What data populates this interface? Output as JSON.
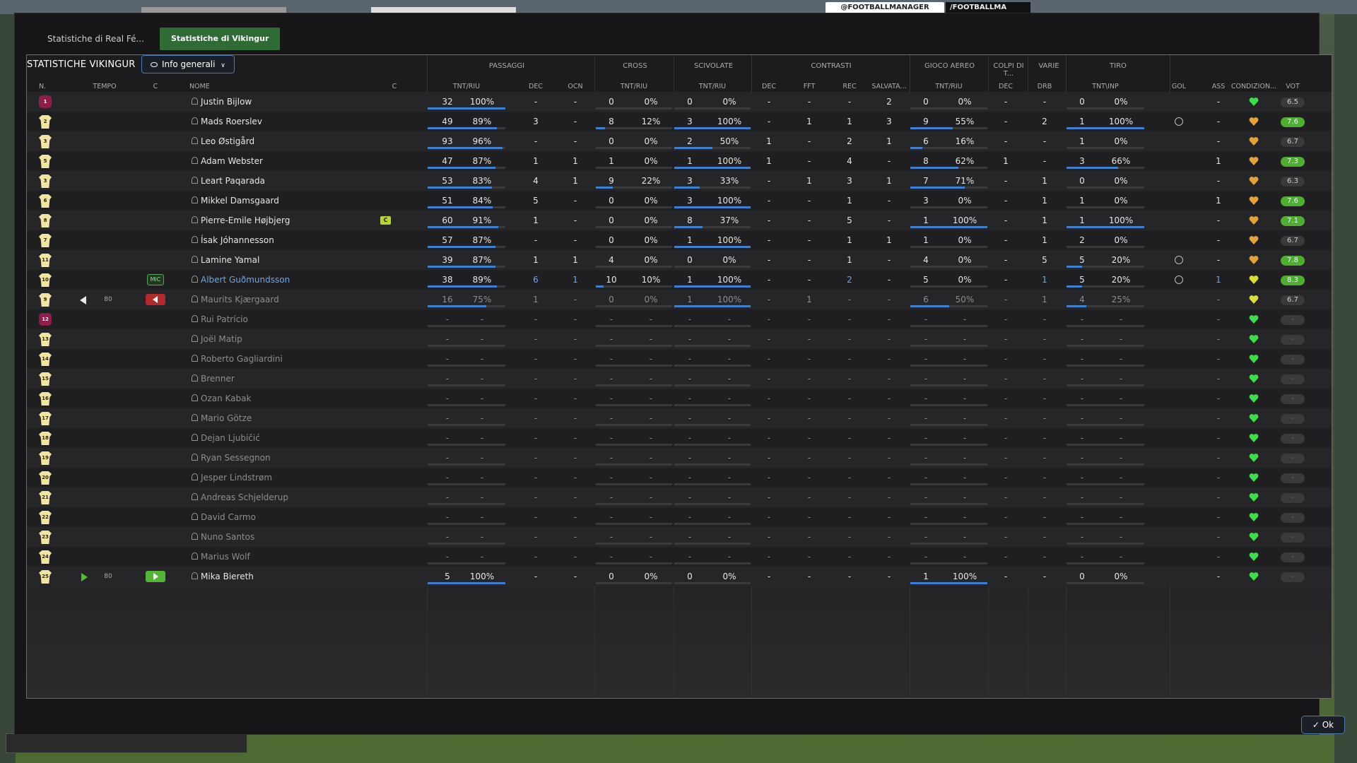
{
  "background": {
    "ad_text_1": "@FOOTBALLMANAGER",
    "ad_text_2": "/FOOTBALLMA"
  },
  "tabs": [
    {
      "label": "Statistiche di Real Fé...",
      "active": false
    },
    {
      "label": "Statistiche di Vikingur",
      "active": true
    }
  ],
  "panel": {
    "title": "STATISTICHE VIKINGUR",
    "filter_label": "Info generali"
  },
  "groups": {
    "passaggi": "PASSAGGI",
    "cross": "CROSS",
    "scivolate": "SCIVOLATE",
    "contrasti": "CONTRASTI",
    "gioco_aereo": "GIOCO AEREO",
    "colpi_di_testa": "COLPI DI T...",
    "varie": "VARIE",
    "tiro": "TIRO"
  },
  "columns": {
    "n": "N.",
    "tempo": "TEMPO",
    "c": "C",
    "nome": "NOME",
    "c2": "C",
    "pass_tnt": "TNT/RIU",
    "pass_dec": "DEC",
    "pass_ocn": "OCN",
    "cross_tnt": "TNT/RIU",
    "sciv_tnt": "TNT/RIU",
    "contr_dec": "DEC",
    "contr_fft": "FFT",
    "contr_rec": "REC",
    "contr_salv": "SALVATA...",
    "aereo_tnt": "TNT/RIU",
    "testa_dec": "DEC",
    "varie_drb": "DRB",
    "tiro_tnt": "TNT\\INP",
    "gol": "GOL",
    "ass": "ASS",
    "condizione": "CONDIZION...",
    "vot": "VOT"
  },
  "players": [
    {
      "n": "1",
      "gk": true,
      "name": "Justin Bijlow",
      "pass_a": "32",
      "pass_p": "100%",
      "pass_fill": 1.0,
      "pass_dec": "-",
      "pass_ocn": "-",
      "cross_a": "0",
      "cross_p": "0%",
      "cross_fill": 0,
      "sciv_a": "0",
      "sciv_p": "0%",
      "sciv_fill": 0,
      "c_dec": "-",
      "c_fft": "-",
      "c_rec": "-",
      "c_salv": "2",
      "aer_a": "0",
      "aer_p": "0%",
      "aer_fill": 0,
      "t_dec": "-",
      "drb": "-",
      "tiro_a": "0",
      "tiro_p": "0%",
      "tiro_fill": 0,
      "gol": "",
      "ass": "-",
      "cond": "green",
      "vot": "6.5",
      "vot_green": false
    },
    {
      "n": "2",
      "name": "Mads Roerslev",
      "pass_a": "49",
      "pass_p": "89%",
      "pass_fill": 0.89,
      "pass_dec": "3",
      "pass_ocn": "-",
      "cross_a": "8",
      "cross_p": "12%",
      "cross_fill": 0.12,
      "sciv_a": "3",
      "sciv_p": "100%",
      "sciv_fill": 1.0,
      "c_dec": "-",
      "c_fft": "1",
      "c_rec": "1",
      "c_salv": "3",
      "aer_a": "9",
      "aer_p": "55%",
      "aer_fill": 0.55,
      "t_dec": "-",
      "drb": "2",
      "tiro_a": "1",
      "tiro_p": "100%",
      "tiro_fill": 1.0,
      "gol": "ball",
      "ass": "-",
      "cond": "orange",
      "vot": "7.6",
      "vot_green": true
    },
    {
      "n": "3",
      "name": "Leo Østigård",
      "pass_a": "93",
      "pass_p": "96%",
      "pass_fill": 0.96,
      "pass_dec": "-",
      "pass_ocn": "-",
      "cross_a": "0",
      "cross_p": "0%",
      "cross_fill": 0,
      "sciv_a": "2",
      "sciv_p": "50%",
      "sciv_fill": 0.5,
      "c_dec": "1",
      "c_fft": "-",
      "c_rec": "2",
      "c_salv": "1",
      "aer_a": "6",
      "aer_p": "16%",
      "aer_fill": 0.16,
      "t_dec": "-",
      "drb": "-",
      "tiro_a": "1",
      "tiro_p": "0%",
      "tiro_fill": 0,
      "gol": "",
      "ass": "-",
      "cond": "orange",
      "vot": "6.7",
      "vot_green": false
    },
    {
      "n": "5",
      "name": "Adam Webster",
      "pass_a": "47",
      "pass_p": "87%",
      "pass_fill": 0.87,
      "pass_dec": "1",
      "pass_ocn": "1",
      "cross_a": "1",
      "cross_p": "0%",
      "cross_fill": 0,
      "sciv_a": "1",
      "sciv_p": "100%",
      "sciv_fill": 1.0,
      "c_dec": "1",
      "c_fft": "-",
      "c_rec": "4",
      "c_salv": "-",
      "aer_a": "8",
      "aer_p": "62%",
      "aer_fill": 0.62,
      "t_dec": "1",
      "drb": "-",
      "tiro_a": "3",
      "tiro_p": "66%",
      "tiro_fill": 0.66,
      "gol": "",
      "ass": "1",
      "cond": "orange",
      "vot": "7.3",
      "vot_green": true
    },
    {
      "n": "3",
      "name": "Leart Paqarada",
      "pass_a": "53",
      "pass_p": "83%",
      "pass_fill": 0.83,
      "pass_dec": "4",
      "pass_ocn": "1",
      "cross_a": "9",
      "cross_p": "22%",
      "cross_fill": 0.22,
      "sciv_a": "3",
      "sciv_p": "33%",
      "sciv_fill": 0.33,
      "c_dec": "-",
      "c_fft": "1",
      "c_rec": "3",
      "c_salv": "1",
      "aer_a": "7",
      "aer_p": "71%",
      "aer_fill": 0.71,
      "t_dec": "-",
      "drb": "1",
      "tiro_a": "0",
      "tiro_p": "0%",
      "tiro_fill": 0,
      "gol": "",
      "ass": "-",
      "cond": "orange",
      "vot": "6.3",
      "vot_green": false
    },
    {
      "n": "6",
      "name": "Mikkel Damsgaard",
      "pass_a": "51",
      "pass_p": "84%",
      "pass_fill": 0.84,
      "pass_dec": "5",
      "pass_ocn": "-",
      "cross_a": "0",
      "cross_p": "0%",
      "cross_fill": 0,
      "sciv_a": "3",
      "sciv_p": "100%",
      "sciv_fill": 1.0,
      "c_dec": "-",
      "c_fft": "-",
      "c_rec": "1",
      "c_salv": "-",
      "aer_a": "3",
      "aer_p": "0%",
      "aer_fill": 0,
      "t_dec": "-",
      "drb": "1",
      "tiro_a": "1",
      "tiro_p": "0%",
      "tiro_fill": 0,
      "gol": "",
      "ass": "1",
      "cond": "orange",
      "vot": "7.6",
      "vot_green": true
    },
    {
      "n": "8",
      "name": "Pierre-Emile Højbjerg",
      "captain": true,
      "cap_label": "C",
      "pass_a": "60",
      "pass_p": "91%",
      "pass_fill": 0.91,
      "pass_dec": "1",
      "pass_ocn": "-",
      "cross_a": "0",
      "cross_p": "0%",
      "cross_fill": 0,
      "sciv_a": "8",
      "sciv_p": "37%",
      "sciv_fill": 0.37,
      "c_dec": "-",
      "c_fft": "-",
      "c_rec": "5",
      "c_salv": "-",
      "aer_a": "1",
      "aer_p": "100%",
      "aer_fill": 1.0,
      "t_dec": "-",
      "drb": "1",
      "tiro_a": "1",
      "tiro_p": "100%",
      "tiro_fill": 1.0,
      "gol": "",
      "ass": "-",
      "cond": "orange",
      "vot": "7.1",
      "vot_green": true
    },
    {
      "n": "7",
      "name": "Ísak Jóhannesson",
      "pass_a": "57",
      "pass_p": "87%",
      "pass_fill": 0.87,
      "pass_dec": "-",
      "pass_ocn": "-",
      "cross_a": "0",
      "cross_p": "0%",
      "cross_fill": 0,
      "sciv_a": "1",
      "sciv_p": "100%",
      "sciv_fill": 1.0,
      "c_dec": "-",
      "c_fft": "-",
      "c_rec": "1",
      "c_salv": "1",
      "aer_a": "1",
      "aer_p": "0%",
      "aer_fill": 0,
      "t_dec": "-",
      "drb": "1",
      "tiro_a": "2",
      "tiro_p": "0%",
      "tiro_fill": 0,
      "gol": "",
      "ass": "-",
      "cond": "orange",
      "vot": "6.7",
      "vot_green": false
    },
    {
      "n": "11",
      "name": "Lamine Yamal",
      "pass_a": "39",
      "pass_p": "87%",
      "pass_fill": 0.87,
      "pass_dec": "1",
      "pass_ocn": "1",
      "cross_a": "4",
      "cross_p": "0%",
      "cross_fill": 0,
      "sciv_a": "0",
      "sciv_p": "0%",
      "sciv_fill": 0,
      "c_dec": "-",
      "c_fft": "-",
      "c_rec": "1",
      "c_salv": "-",
      "aer_a": "4",
      "aer_p": "0%",
      "aer_fill": 0,
      "t_dec": "-",
      "drb": "5",
      "tiro_a": "5",
      "tiro_p": "20%",
      "tiro_fill": 0.2,
      "gol": "ball",
      "ass": "-",
      "cond": "orange",
      "vot": "7.8",
      "vot_green": true
    },
    {
      "n": "10",
      "name": "Albert Guðmundsson",
      "highlight": true,
      "mc": true,
      "mc_label": "MiC",
      "pass_a": "38",
      "pass_p": "89%",
      "pass_fill": 0.89,
      "pass_dec": "6",
      "pass_ocn": "1",
      "cross_a": "10",
      "cross_p": "10%",
      "cross_fill": 0.1,
      "sciv_a": "1",
      "sciv_p": "100%",
      "sciv_fill": 1.0,
      "c_dec": "-",
      "c_fft": "-",
      "c_rec": "2",
      "c_salv": "-",
      "aer_a": "5",
      "aer_p": "0%",
      "aer_fill": 0,
      "t_dec": "-",
      "drb": "1",
      "tiro_a": "5",
      "tiro_p": "20%",
      "tiro_fill": 0.2,
      "gol": "ball",
      "ass": "1",
      "cond": "yellow",
      "vot": "8.3",
      "vot_green": true
    },
    {
      "n": "9",
      "name": "Maurits Kjærgaard",
      "dim": true,
      "sub_out": true,
      "tempo": "80",
      "pass_a": "16",
      "pass_p": "75%",
      "pass_fill": 0.75,
      "pass_dec": "1",
      "pass_ocn": "-",
      "cross_a": "0",
      "cross_p": "0%",
      "cross_fill": 0,
      "sciv_a": "1",
      "sciv_p": "100%",
      "sciv_fill": 1.0,
      "c_dec": "-",
      "c_fft": "1",
      "c_rec": "-",
      "c_salv": "-",
      "aer_a": "6",
      "aer_p": "50%",
      "aer_fill": 0.5,
      "t_dec": "-",
      "drb": "1",
      "tiro_a": "4",
      "tiro_p": "25%",
      "tiro_fill": 0.25,
      "gol": "",
      "ass": "-",
      "cond": "yellow",
      "vot": "6.7",
      "vot_green": false
    },
    {
      "n": "12",
      "gk": true,
      "name": "Rui Patrício",
      "dim": true,
      "empty": true
    },
    {
      "n": "13",
      "name": "Joël Matip",
      "dim": true,
      "empty": true
    },
    {
      "n": "14",
      "name": "Roberto Gagliardini",
      "dim": true,
      "empty": true
    },
    {
      "n": "15",
      "name": "Brenner",
      "dim": true,
      "empty": true
    },
    {
      "n": "16",
      "name": "Ozan Kabak",
      "dim": true,
      "empty": true
    },
    {
      "n": "17",
      "name": "Mario Götze",
      "dim": true,
      "empty": true
    },
    {
      "n": "18",
      "name": "Dejan Ljubičić",
      "dim": true,
      "empty": true
    },
    {
      "n": "19",
      "name": "Ryan Sessegnon",
      "dim": true,
      "empty": true
    },
    {
      "n": "20",
      "name": "Jesper Lindstrøm",
      "dim": true,
      "empty": true
    },
    {
      "n": "21",
      "name": "Andreas Schjelderup",
      "dim": true,
      "empty": true
    },
    {
      "n": "22",
      "name": "David Carmo",
      "dim": true,
      "empty": true
    },
    {
      "n": "23",
      "name": "Nuno Santos",
      "dim": true,
      "empty": true
    },
    {
      "n": "24",
      "name": "Marius Wolf",
      "dim": true,
      "empty": true
    },
    {
      "n": "25",
      "name": "Mika Biereth",
      "sub_in": true,
      "tempo": "80",
      "pass_a": "5",
      "pass_p": "100%",
      "pass_fill": 1.0,
      "pass_dec": "-",
      "pass_ocn": "-",
      "cross_a": "0",
      "cross_p": "0%",
      "cross_fill": 0,
      "sciv_a": "0",
      "sciv_p": "0%",
      "sciv_fill": 0,
      "c_dec": "-",
      "c_fft": "-",
      "c_rec": "-",
      "c_salv": "-",
      "aer_a": "1",
      "aer_p": "100%",
      "aer_fill": 1.0,
      "t_dec": "-",
      "drb": "-",
      "tiro_a": "0",
      "tiro_p": "0%",
      "tiro_fill": 0,
      "gol": "",
      "ass": "-",
      "cond": "green",
      "vot": "-",
      "vot_green": false
    }
  ],
  "ok_label": "Ok",
  "colors": {
    "accent_blue": "#3d7fd0",
    "active_tab": "#2e6b35",
    "vot_green": "#4fae2f",
    "heart_green": "#3ddc4a",
    "heart_orange": "#e3a23a",
    "heart_yellow": "#d8de35"
  }
}
